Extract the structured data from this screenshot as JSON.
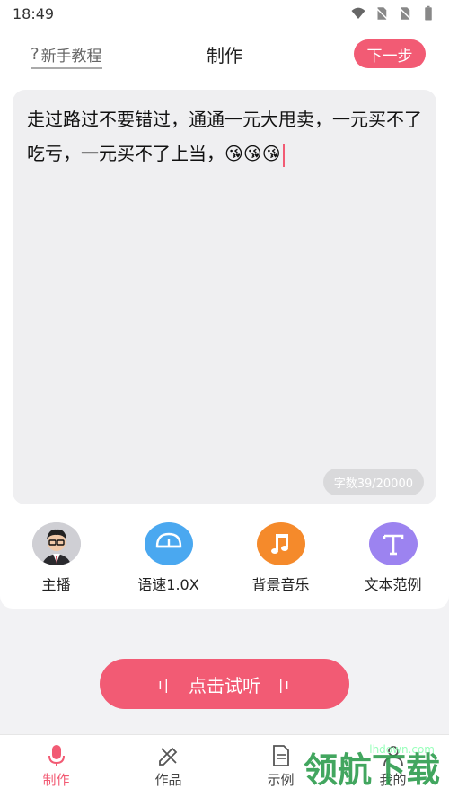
{
  "status": {
    "time": "18:49"
  },
  "header": {
    "tutorial": "新手教程",
    "title": "制作",
    "next": "下一步"
  },
  "editor": {
    "text": "走过路过不要错过，通通一元大甩卖，一元买不了吃亏，一元买不了上当，😘😘😘",
    "count": "字数39/20000"
  },
  "tools": [
    {
      "label": "主播",
      "icon": "avatar-icon"
    },
    {
      "label": "语速1.0X",
      "icon": "speed-gauge-icon",
      "color": "#4aa8f0"
    },
    {
      "label": "背景音乐",
      "icon": "music-note-icon",
      "color": "#f58a2b"
    },
    {
      "label": "文本范例",
      "icon": "text-t-icon",
      "color": "#9c83f0"
    }
  ],
  "listen": {
    "label": "点击试听"
  },
  "nav": [
    {
      "label": "制作",
      "icon": "microphone-icon"
    },
    {
      "label": "作品",
      "icon": "pencil-ruler-icon"
    },
    {
      "label": "示例",
      "icon": "document-icon"
    },
    {
      "label": "我的",
      "icon": "user-icon"
    }
  ],
  "watermark": {
    "main": "领航下载",
    "sub": "lhdown.com"
  },
  "colors": {
    "accent": "#f25b74"
  }
}
